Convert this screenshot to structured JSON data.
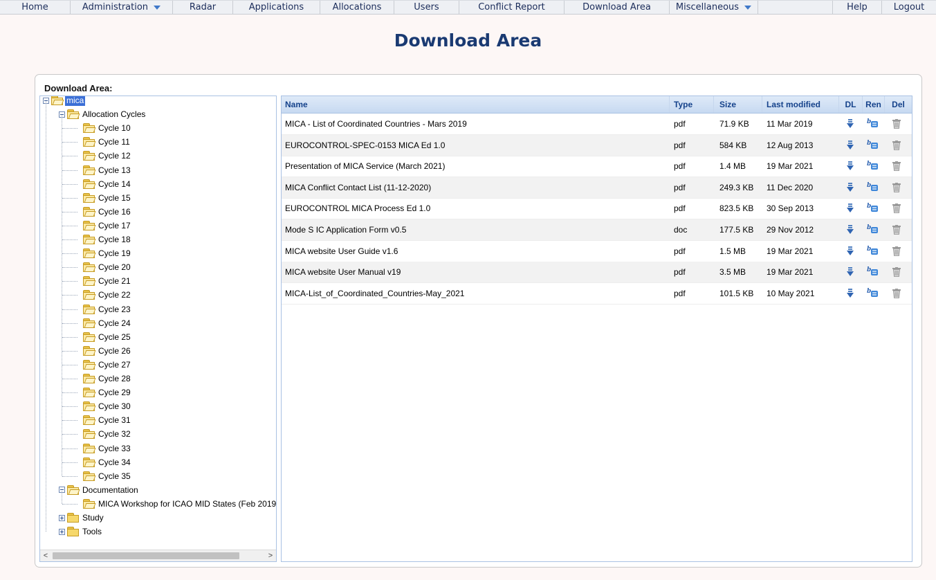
{
  "nav": {
    "items": [
      "Home",
      "Administration",
      "Radar",
      "Applications",
      "Allocations",
      "Users",
      "Conflict Report",
      "Download Area",
      "Miscellaneous",
      "Help",
      "Logout"
    ]
  },
  "page": {
    "title": "Download Area",
    "panel_title": "Download Area:"
  },
  "tree": {
    "root": "mica",
    "allocation_cycles": "Allocation Cycles",
    "cycles": [
      "Cycle 10",
      "Cycle 11",
      "Cycle 12",
      "Cycle 13",
      "Cycle 14",
      "Cycle 15",
      "Cycle 16",
      "Cycle 17",
      "Cycle 18",
      "Cycle 19",
      "Cycle 20",
      "Cycle 21",
      "Cycle 22",
      "Cycle 23",
      "Cycle 24",
      "Cycle 25",
      "Cycle 26",
      "Cycle 27",
      "Cycle 28",
      "Cycle 29",
      "Cycle 30",
      "Cycle 31",
      "Cycle 32",
      "Cycle 33",
      "Cycle 34",
      "Cycle 35"
    ],
    "documentation": "Documentation",
    "documentation_children": [
      "MICA Workshop for ICAO MID States (Feb 2019)"
    ],
    "study": "Study",
    "tools": "Tools",
    "scroll_left": "<",
    "scroll_right": ">"
  },
  "grid": {
    "headers": {
      "name": "Name",
      "type": "Type",
      "size": "Size",
      "modified": "Last modified",
      "dl": "DL",
      "ren": "Ren",
      "del": "Del"
    },
    "rows": [
      {
        "name": "MICA - List of Coordinated Countries - Mars 2019",
        "type": "pdf",
        "size": "71.9 KB",
        "modified": "11 Mar 2019"
      },
      {
        "name": "EUROCONTROL-SPEC-0153 MICA Ed 1.0",
        "type": "pdf",
        "size": "584 KB",
        "modified": "12 Aug 2013"
      },
      {
        "name": "Presentation of MICA Service (March 2021)",
        "type": "pdf",
        "size": "1.4 MB",
        "modified": "19 Mar 2021"
      },
      {
        "name": "MICA Conflict Contact List (11-12-2020)",
        "type": "pdf",
        "size": "249.3 KB",
        "modified": "11 Dec 2020"
      },
      {
        "name": "EUROCONTROL MICA Process Ed 1.0",
        "type": "pdf",
        "size": "823.5 KB",
        "modified": "30 Sep 2013"
      },
      {
        "name": "Mode S IC Application Form v0.5",
        "type": "doc",
        "size": "177.5 KB",
        "modified": "29 Nov 2012"
      },
      {
        "name": "MICA website User Guide v1.6",
        "type": "pdf",
        "size": "1.5 MB",
        "modified": "19 Mar 2021"
      },
      {
        "name": "MICA website User Manual v19",
        "type": "pdf",
        "size": "3.5 MB",
        "modified": "19 Mar 2021"
      },
      {
        "name": "MICA-List_of_Coordinated_Countries-May_2021",
        "type": "pdf",
        "size": "101.5 KB",
        "modified": "10 May 2021"
      }
    ]
  },
  "icons": {
    "download": "download-icon",
    "rename": "rename-icon",
    "delete": "trash-icon",
    "folder": "folder-icon",
    "dropdown": "chevron-down-icon"
  },
  "colors": {
    "title": "#1a3a72",
    "selected": "#3b6fd6",
    "header_text": "#15428b"
  }
}
